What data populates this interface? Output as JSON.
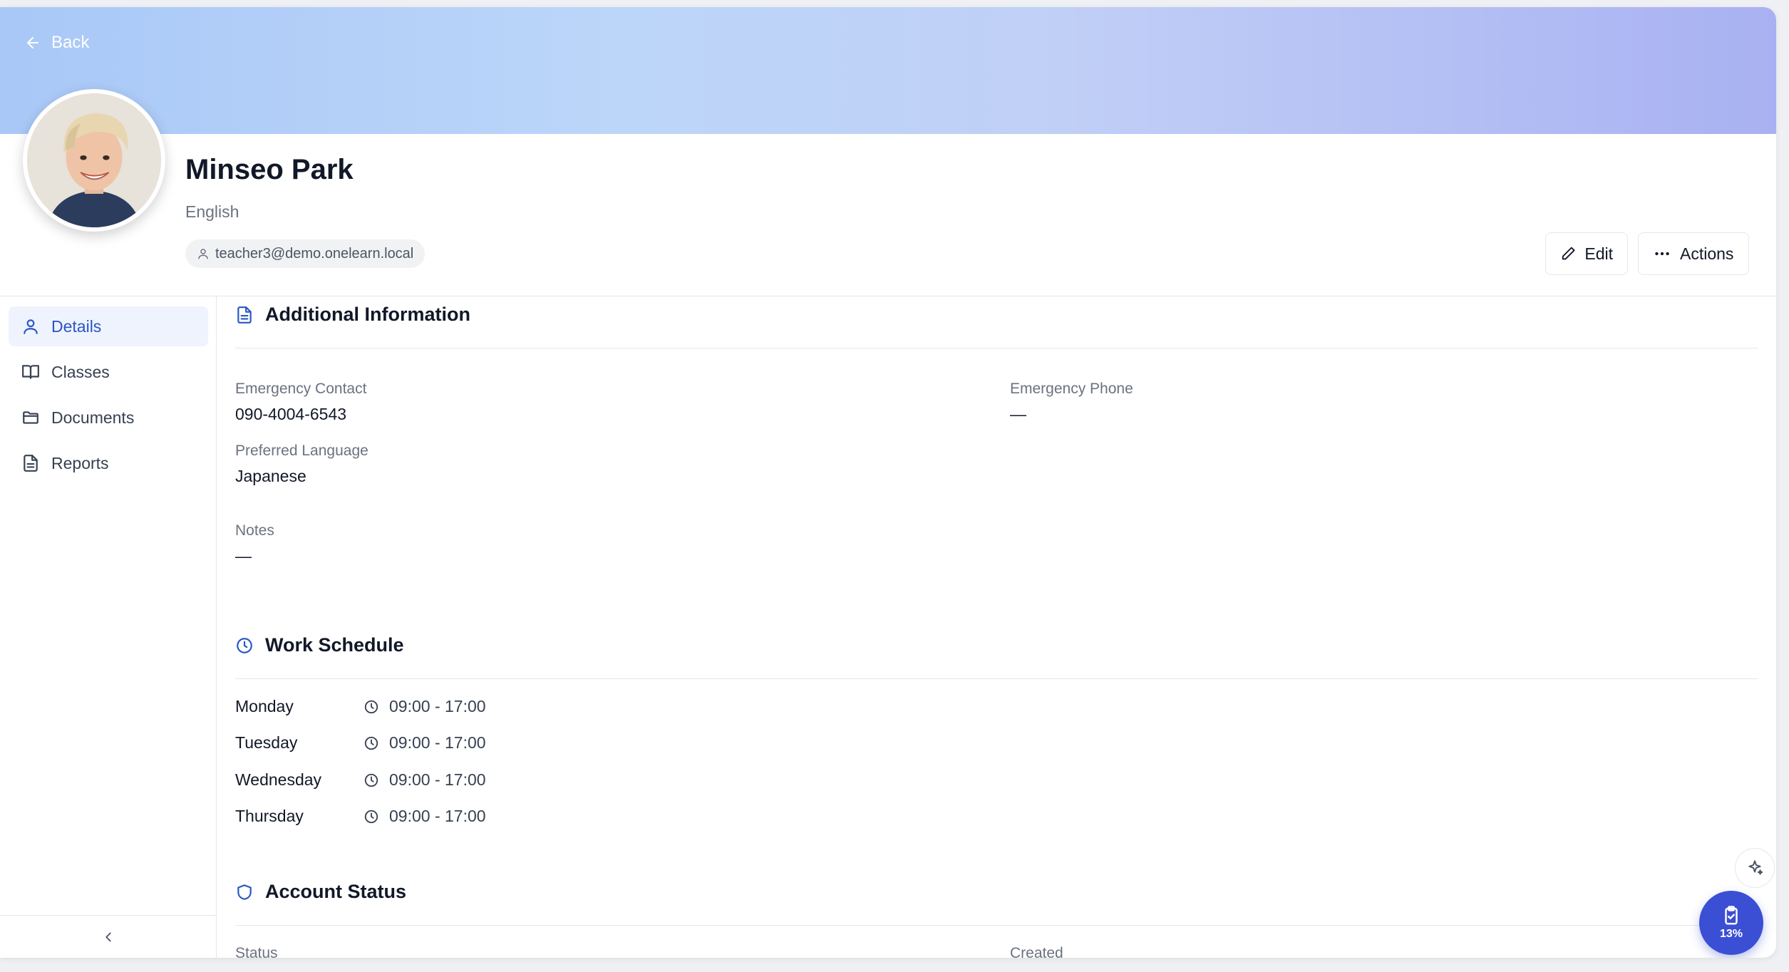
{
  "header": {
    "back_label": "Back",
    "name": "Minseo Park",
    "subject": "English",
    "email": "teacher3@demo.onelearn.local",
    "edit_label": "Edit",
    "actions_label": "Actions"
  },
  "sidebar": {
    "items": [
      {
        "label": "Details",
        "icon": "user-icon",
        "active": true
      },
      {
        "label": "Classes",
        "icon": "book-icon",
        "active": false
      },
      {
        "label": "Documents",
        "icon": "folder-icon",
        "active": false
      },
      {
        "label": "Reports",
        "icon": "file-text-icon",
        "active": false
      }
    ]
  },
  "additional_info": {
    "title": "Additional Information",
    "emergency_contact_label": "Emergency Contact",
    "emergency_contact_value": "090-4004-6543",
    "emergency_phone_label": "Emergency Phone",
    "emergency_phone_value": "—",
    "preferred_language_label": "Preferred Language",
    "preferred_language_value": "Japanese",
    "notes_label": "Notes",
    "notes_value": "—"
  },
  "work_schedule": {
    "title": "Work Schedule",
    "days": [
      {
        "day": "Monday",
        "time": "09:00 - 17:00"
      },
      {
        "day": "Tuesday",
        "time": "09:00 - 17:00"
      },
      {
        "day": "Wednesday",
        "time": "09:00 - 17:00"
      },
      {
        "day": "Thursday",
        "time": "09:00 - 17:00"
      }
    ]
  },
  "account_status": {
    "title": "Account Status",
    "status_label": "Status",
    "created_label": "Created"
  },
  "progress_fab": {
    "percent": "13%"
  },
  "colors": {
    "accent": "#2a55c4",
    "fab": "#3b4fd4",
    "active_bg": "#eef3fd"
  }
}
